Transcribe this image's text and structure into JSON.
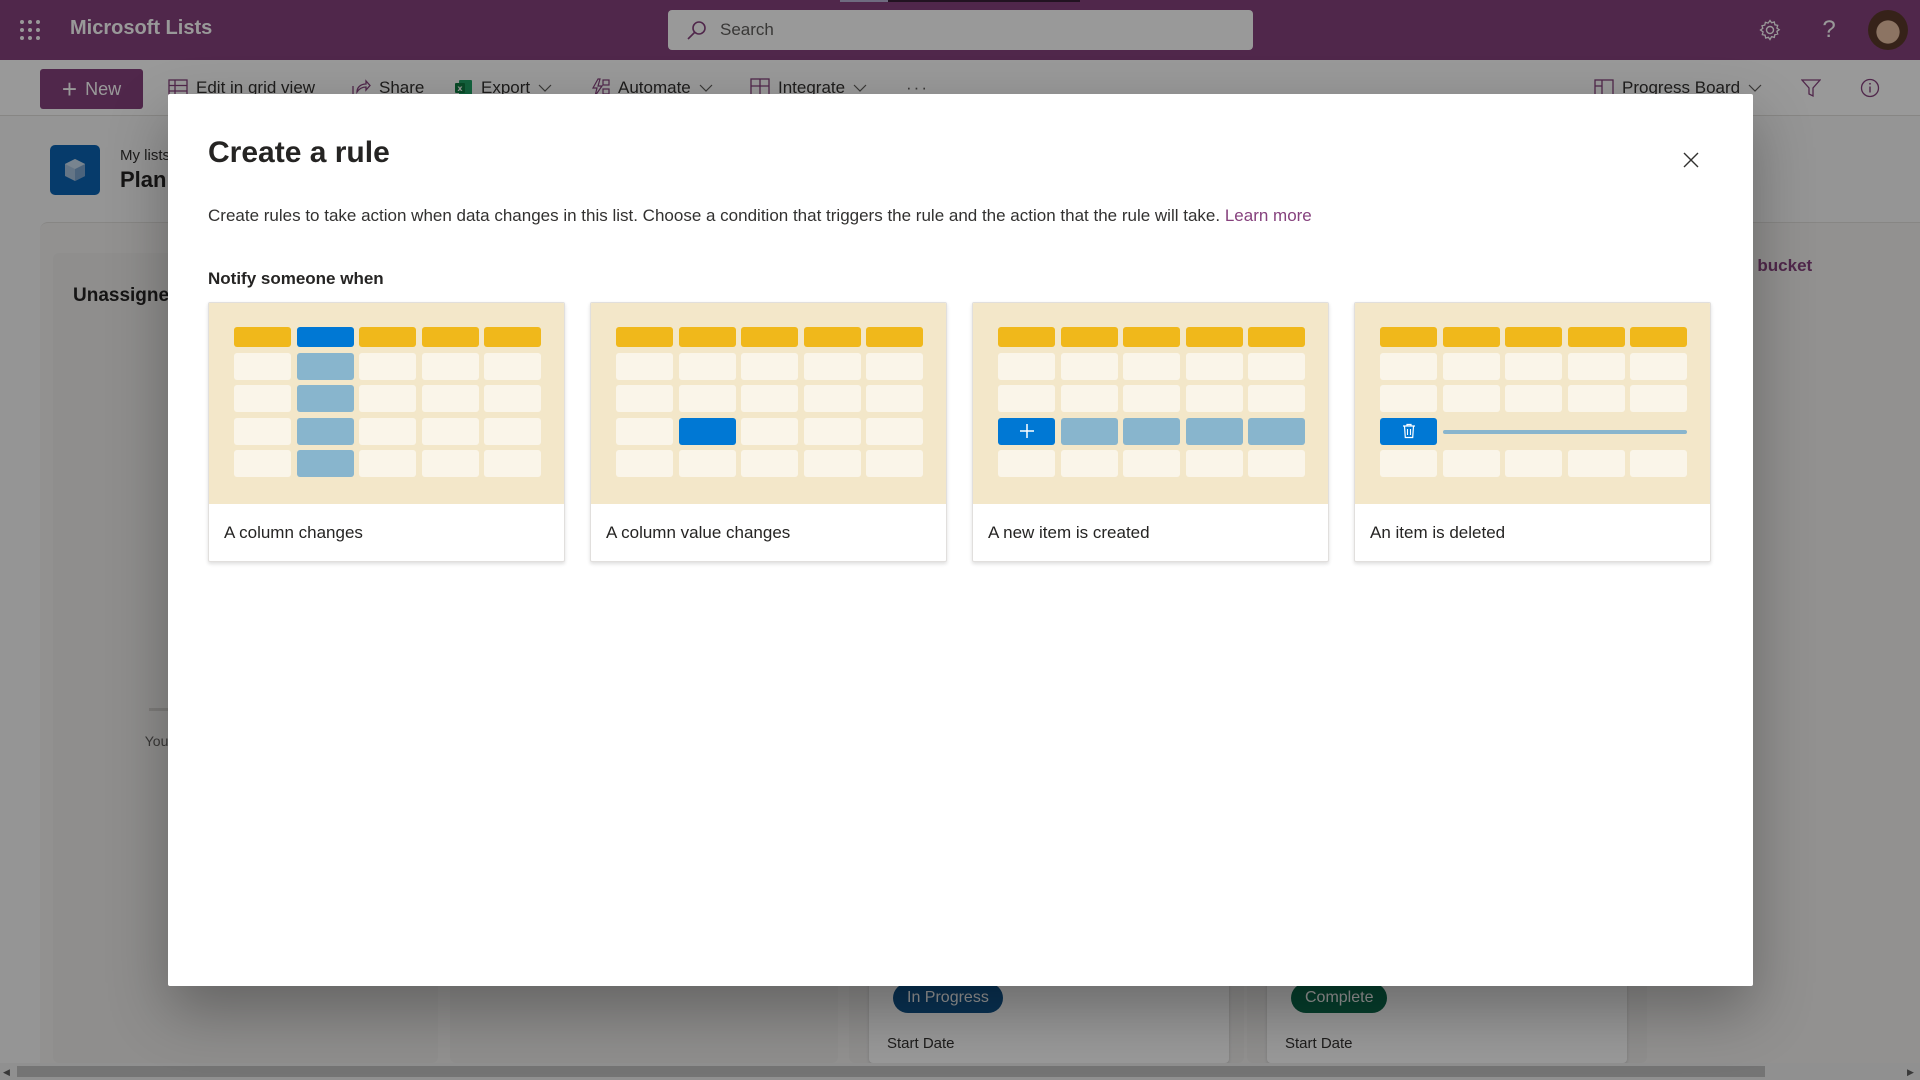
{
  "header": {
    "app_title": "Microsoft Lists",
    "search_placeholder": "Search",
    "icons": [
      "app-launcher-icon",
      "settings-icon",
      "help-icon",
      "avatar"
    ]
  },
  "toolbar": {
    "new_label": "New",
    "edit_grid_label": "Edit in grid view",
    "share_label": "Share",
    "export_label": "Export",
    "automate_label": "Automate",
    "integrate_label": "Integrate",
    "more_label": "···",
    "view_label": "Progress Board"
  },
  "list": {
    "breadcrumb": "My lists",
    "name": "Planning"
  },
  "board": {
    "buckets": [
      {
        "title": "Unassigned",
        "empty_text": "You can drag items here from the other buckets."
      },
      {
        "title": ""
      },
      {
        "title": "",
        "card_status": "In Progress",
        "card_status_color": "#0f548c",
        "card_field": "Start Date"
      },
      {
        "title": "",
        "card_status": "Complete",
        "card_status_color": "#0b6a4b",
        "card_field": "Start Date"
      }
    ],
    "new_bucket_label": "ew bucket"
  },
  "dialog": {
    "title": "Create a rule",
    "description": "Create rules to take action when data changes in this list. Choose a condition that triggers the rule and the action that the rule will take.",
    "learn_more": "Learn more",
    "section_label": "Notify someone when",
    "options": [
      {
        "label": "A column changes",
        "illustration": "column-highlight"
      },
      {
        "label": "A column value changes",
        "illustration": "cell-highlight"
      },
      {
        "label": "A new item is created",
        "illustration": "row-added"
      },
      {
        "label": "An item is deleted",
        "illustration": "row-deleted"
      }
    ]
  },
  "colors": {
    "brand": "#86417d",
    "illustration_bg": "#f3e7c9",
    "header_cell": "#f0b81b",
    "accent_blue": "#0078d4",
    "light_blue": "#88b5cd"
  }
}
